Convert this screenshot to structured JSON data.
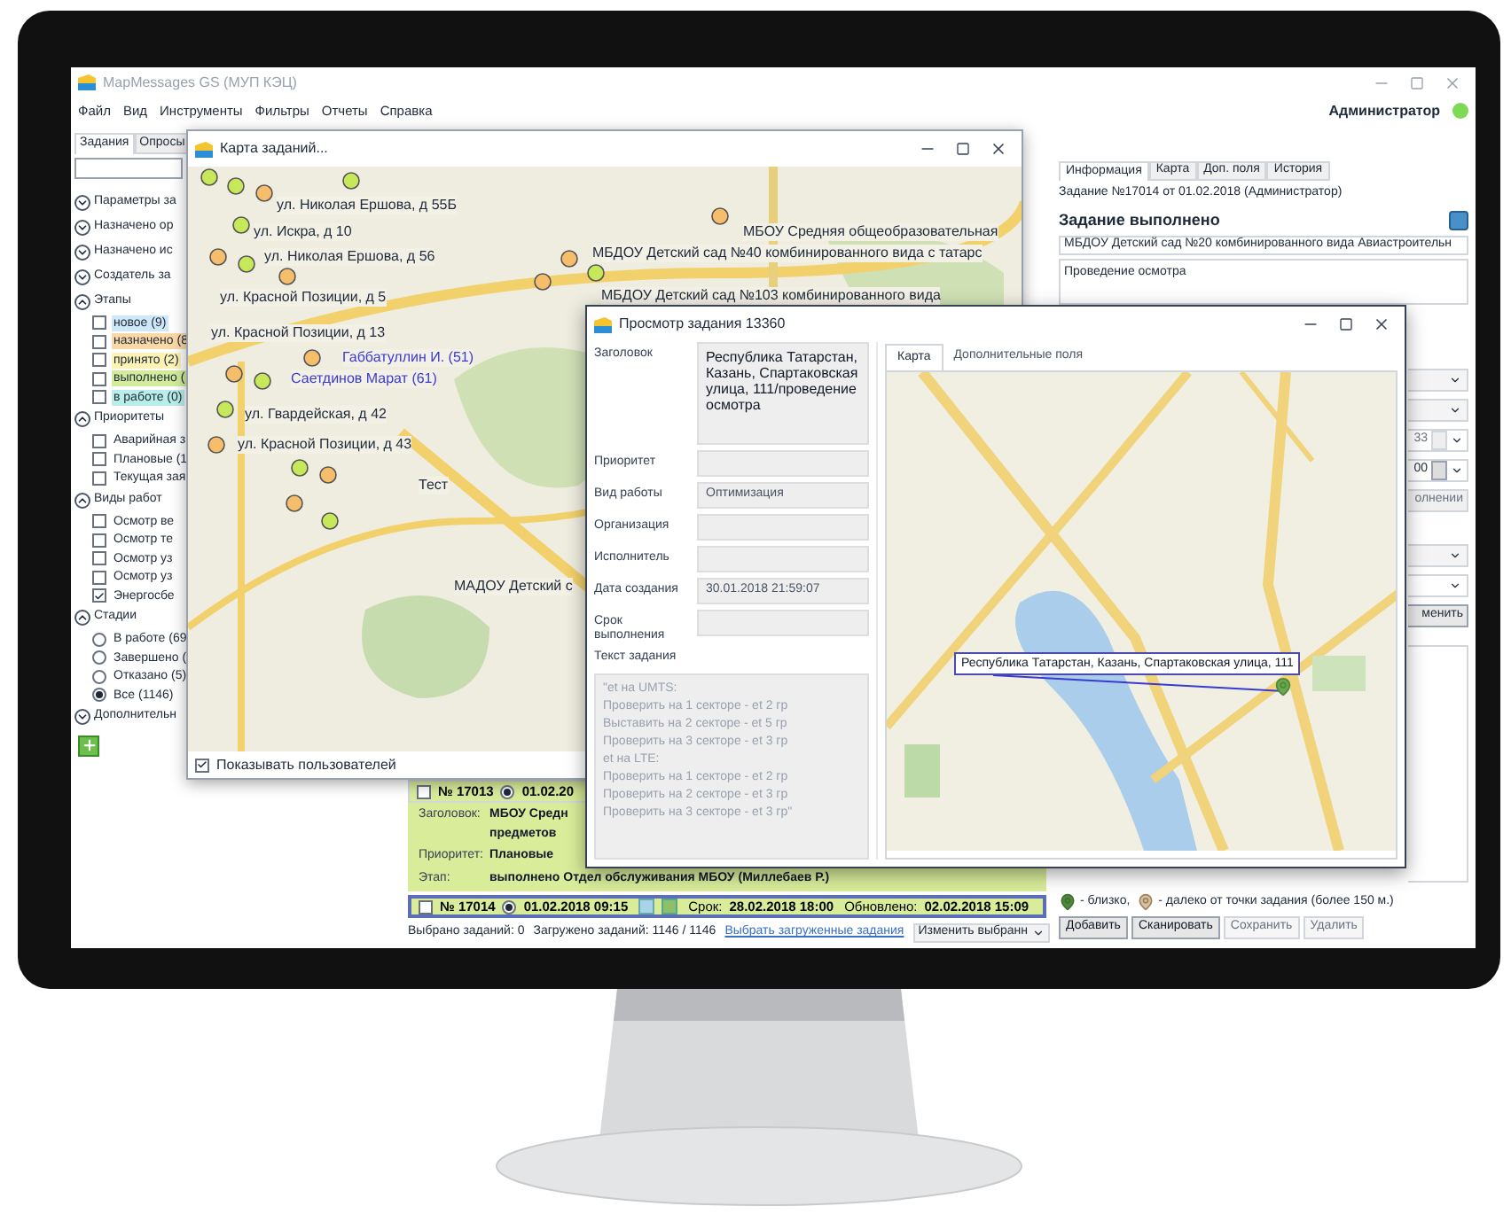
{
  "window": {
    "title": "MapMessages GS (МУП КЭЦ)"
  },
  "menu": [
    "Файл",
    "Вид",
    "Инструменты",
    "Фильтры",
    "Отчеты",
    "Справка"
  ],
  "user": {
    "name": "Администратор",
    "online": true
  },
  "left_panel": {
    "tabs": [
      {
        "label": "Задания",
        "selected": true
      },
      {
        "label": "Опросы",
        "selected": false
      }
    ],
    "filter_sections": [
      {
        "label": "Параметры за",
        "expanded": false
      },
      {
        "label": "Назначено ор",
        "expanded": false
      },
      {
        "label": "Назначено ис",
        "expanded": false
      },
      {
        "label": "Создатель за",
        "expanded": false
      },
      {
        "label": "Этапы",
        "expanded": true,
        "items": [
          {
            "kind": "checkbox",
            "label": "новое (9)",
            "checked": false,
            "color": "#cfe8f7"
          },
          {
            "kind": "checkbox",
            "label": "назначено (8",
            "checked": false,
            "color": "#fbd9a6"
          },
          {
            "kind": "checkbox",
            "label": "принято (2)",
            "checked": false,
            "color": "#fdf3b4"
          },
          {
            "kind": "checkbox",
            "label": "выполнено (",
            "checked": false,
            "color": "#d3ec9b"
          },
          {
            "kind": "checkbox",
            "label": "в работе (0)",
            "checked": false,
            "color": "#b9ede9"
          }
        ]
      },
      {
        "label": "Приоритеты",
        "expanded": true,
        "items": [
          {
            "kind": "checkbox",
            "label": "Аварийная з",
            "checked": false
          },
          {
            "kind": "checkbox",
            "label": "Плановые (1",
            "checked": false
          },
          {
            "kind": "checkbox",
            "label": "Текущая зая",
            "checked": false
          }
        ]
      },
      {
        "label": "Виды работ",
        "expanded": true,
        "items": [
          {
            "kind": "checkbox",
            "label": "Осмотр ве",
            "checked": false
          },
          {
            "kind": "checkbox",
            "label": "Осмотр те",
            "checked": false
          },
          {
            "kind": "checkbox",
            "label": "Осмотр уз",
            "checked": false
          },
          {
            "kind": "checkbox",
            "label": "Осмотр уз",
            "checked": false
          },
          {
            "kind": "checkbox",
            "label": "Энергосбе",
            "checked": true
          }
        ]
      },
      {
        "label": "Стадии",
        "expanded": true,
        "items": [
          {
            "kind": "radio",
            "label": "В работе (69",
            "selected": false
          },
          {
            "kind": "radio",
            "label": "Завершено (",
            "selected": false
          },
          {
            "kind": "radio",
            "label": "Отказано (5)",
            "selected": false
          },
          {
            "kind": "radio",
            "label": "Все (1146)",
            "selected": true
          }
        ]
      },
      {
        "label": "Дополнительн",
        "expanded": false
      }
    ]
  },
  "map_window": {
    "title": "Карта заданий...",
    "labels": [
      {
        "kind": "address",
        "text": "ул. Николая Ершова, д 55Б"
      },
      {
        "kind": "address",
        "text": "ул. Искра, д 10"
      },
      {
        "kind": "address",
        "text": "ул. Николая Ершова, д 56"
      },
      {
        "kind": "address",
        "text": "ул. Красной Позиции, д 5"
      },
      {
        "kind": "address",
        "text": "ул. Красной Позиции, д 13"
      },
      {
        "kind": "user",
        "text": "Габбатуллин И. (51)"
      },
      {
        "kind": "user",
        "text": "Саетдинов Марат (61)"
      },
      {
        "kind": "address",
        "text": "ул. Гвардейская, д 42"
      },
      {
        "kind": "address",
        "text": "ул. Красной Позиции, д 43"
      },
      {
        "kind": "address",
        "text": "Тест"
      },
      {
        "kind": "address",
        "text": "МАДОУ Детский с"
      },
      {
        "kind": "address",
        "text": "МБОУ Средняя общеобразовательная"
      },
      {
        "kind": "address",
        "text": "МБДОУ Детский сад №40 комбинированного вида с татарс"
      },
      {
        "kind": "address",
        "text": "МБДОУ Детский сад №103 комбинированного вида"
      }
    ],
    "show_users": {
      "label": "Показывать пользователей",
      "checked": true
    }
  },
  "tasks": [
    {
      "number": "№ 17013",
      "date": "01.02.20",
      "checked": false,
      "radio": true,
      "selected": false,
      "details": [
        {
          "label": "Заголовок:",
          "value": "МБОУ Средн\nпредметов"
        },
        {
          "label": "Приоритет:",
          "value": "Плановые"
        },
        {
          "label": "Этап:",
          "value": "выполнено Отдел обслуживания МБОУ (Миллебаев Р.)"
        }
      ]
    },
    {
      "number": "№ 17014",
      "date": "01.02.2018 09:15",
      "checked": false,
      "radio": true,
      "selected": true,
      "due_label": "Срок:",
      "due": "28.02.2018 18:00",
      "updated_label": "Обновлено:",
      "updated": "02.02.2018 15:09"
    }
  ],
  "status_bar": {
    "selected": "Выбрано заданий: 0",
    "loaded": "Загружено заданий: 1146 / 1146",
    "link": "Выбрать загруженные задания",
    "action": "Изменить выбранн"
  },
  "right_panel": {
    "tabs": [
      {
        "label": "Информация",
        "selected": true
      },
      {
        "label": "Карта",
        "selected": false
      },
      {
        "label": "Доп. поля",
        "selected": false
      },
      {
        "label": "История",
        "selected": false
      }
    ],
    "header": "Задание №17014 от 01.02.2018 (Администратор)",
    "status": "Задание выполнено",
    "organization": "МБДОУ Детский сад №20 комбинированного вида Авиастроительн",
    "description": "Проведение осмотра",
    "time_start": "33",
    "time_end": "00",
    "button_1": "олнении",
    "button_2": "менить",
    "legend": {
      "near": "- близко,",
      "far": "- далеко от точки задания (более 150 м.)"
    },
    "buttons": [
      {
        "label": "Добавить",
        "disabled": false
      },
      {
        "label": "Сканировать",
        "disabled": false
      },
      {
        "label": "Сохранить",
        "disabled": true
      },
      {
        "label": "Удалить",
        "disabled": true
      }
    ]
  },
  "popup": {
    "title": "Просмотр задания 13360",
    "fields": [
      {
        "kind": "multiline",
        "label": "Заголовок",
        "value": "Республика Татарстан, Казань, Спартаковская улица, 111/проведение осмотра"
      },
      {
        "kind": "line",
        "label": "Приоритет"
      },
      {
        "kind": "line",
        "label": "Вид работы",
        "value": "Оптимизация"
      },
      {
        "kind": "line",
        "label": "Организация"
      },
      {
        "kind": "line",
        "label": "Исполнитель"
      },
      {
        "kind": "line",
        "label": "Дата создания",
        "value": "30.01.2018 21:59:07"
      },
      {
        "kind": "line",
        "label": "Срок выполнения"
      }
    ],
    "text_label": "Текст задания",
    "text": "\"et на UMTS:\nПроверить на 1 секторе - et 2 гр\nВыставить на 2 секторе - et 5 гр\nПроверить на 3 секторе - et 3 гр\net на LTE:\nПроверить на 1 секторе - et 2 гр\nПроверить на 2 секторе - et 3 гр\nПроверить на 3 секторе - et 3 гр\"",
    "tabs": [
      {
        "label": "Карта",
        "selected": true
      },
      {
        "label": "Дополнительные поля",
        "selected": false
      }
    ],
    "callout": "Республика Татарстан, Казань, Спартаковская улица, 111"
  }
}
